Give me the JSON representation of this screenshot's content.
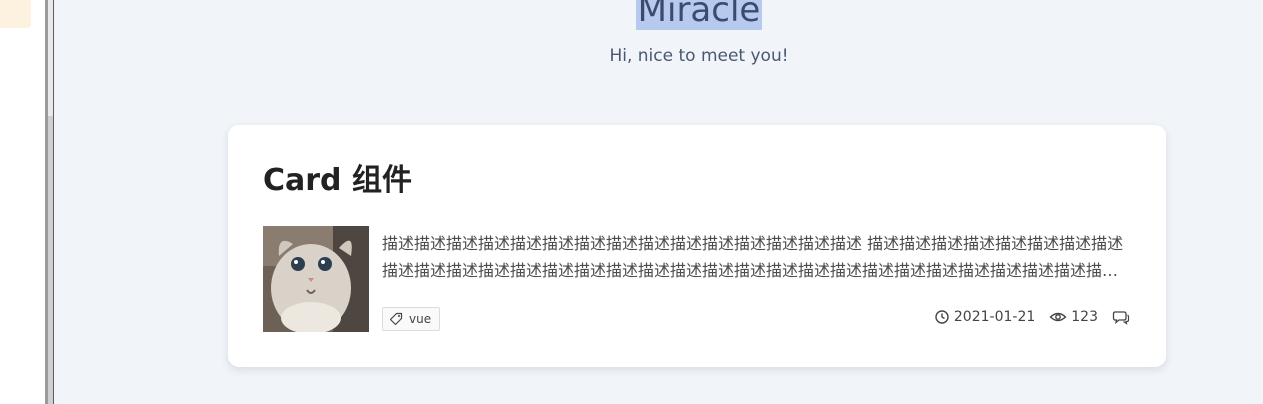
{
  "header": {
    "title": "Miracle",
    "subtitle": "Hi, nice to meet you!"
  },
  "card": {
    "title": "Card 组件",
    "thumbnail_alt": "cat photo",
    "description": "描述描述描述描述描述描述描述描述描述描述描述描述描述描述描述 描述描述描述描述描述描述描述描述描述描述描述描述描述描述描述描述描述描述描述描述描述描述描述描述描述描述描述描述描述描述描述描述描述描述描述描述描述描述描述描述描述描述",
    "tag_label": "vue",
    "date": "2021-01-21",
    "views": "123"
  },
  "colors": {
    "page_bg": "#f1f4f8",
    "title_highlight": "#b6c9ee",
    "card_bg": "#ffffff"
  }
}
